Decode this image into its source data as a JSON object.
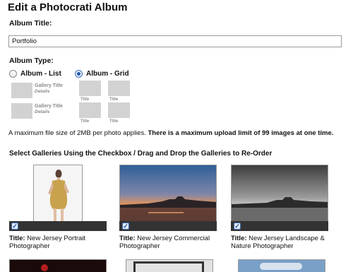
{
  "header": {
    "title": "Edit a Photocrati Album"
  },
  "album_title": {
    "label": "Album Title:",
    "value": "Portfolio"
  },
  "album_type": {
    "label": "Album Type:",
    "options": [
      {
        "label": "Album - List",
        "selected": false
      },
      {
        "label": "Album - Grid",
        "selected": true
      }
    ],
    "list_preview": {
      "gallery_title": "Gallery Title",
      "details": "Details"
    },
    "grid_preview": {
      "item_title": "Title"
    }
  },
  "upload_note": {
    "prefix": "A maximum file size of 2MB per photo applies. ",
    "bold": "There is a maximum upload limit of 99 images at one time."
  },
  "galleries": {
    "heading": "Select Galleries Using the Checkbox / Drag and Drop the Galleries to Re-Order",
    "title_prefix": "Title:",
    "checkmark": "✓",
    "items": [
      {
        "title": "New Jersey Portrait Photographer",
        "checked": true
      },
      {
        "title": "New Jersey Commercial Photographer",
        "checked": true
      },
      {
        "title": "New Jersey Landscape & Nature Photographer",
        "checked": true
      }
    ]
  }
}
